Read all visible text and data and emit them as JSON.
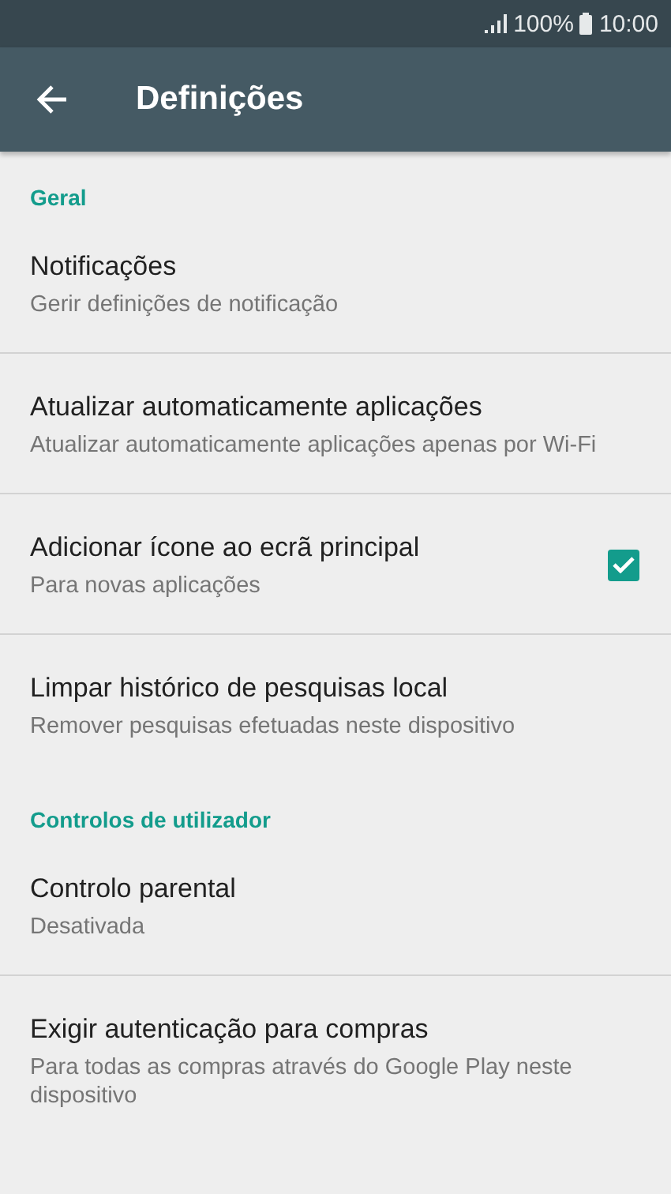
{
  "status_bar": {
    "battery": "100%",
    "time": "10:00"
  },
  "app_bar": {
    "title": "Definições"
  },
  "sections": [
    {
      "header": "Geral",
      "items": [
        {
          "kind": "plain",
          "title": "Notificações",
          "subtitle": "Gerir definições de notificação"
        },
        {
          "kind": "plain",
          "title": "Atualizar automaticamente aplicações",
          "subtitle": "Atualizar automaticamente aplicações apenas por Wi-Fi"
        },
        {
          "kind": "checkbox",
          "title": "Adicionar ícone ao ecrã principal",
          "subtitle": "Para novas aplicações",
          "checked": true
        },
        {
          "kind": "plain",
          "title": "Limpar histórico de pesquisas local",
          "subtitle": "Remover pesquisas efetuadas neste dispositivo"
        }
      ]
    },
    {
      "header": "Controlos de utilizador",
      "items": [
        {
          "kind": "plain",
          "title": "Controlo parental",
          "subtitle": "Desativada"
        },
        {
          "kind": "plain",
          "title": "Exigir autenticação para compras",
          "subtitle": "Para todas as compras através do Google Play neste dispositivo"
        }
      ]
    }
  ]
}
